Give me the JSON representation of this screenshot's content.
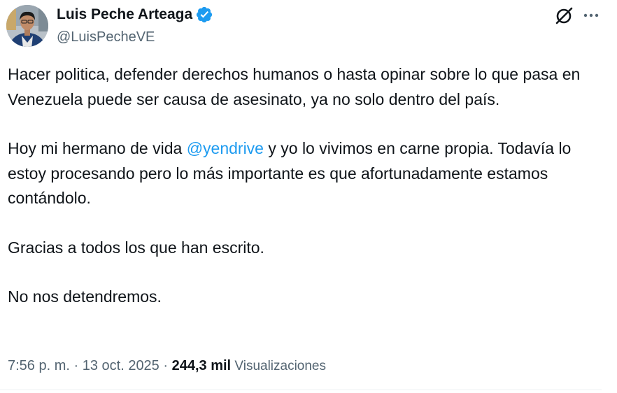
{
  "author": {
    "name": "Luis Peche Arteaga",
    "handle": "@LuisPecheVE",
    "verified_color": "#1d9bf0"
  },
  "icons": {
    "avatar": "profile-photo",
    "verified": "verified-badge-icon",
    "grok": "grok-icon",
    "more": "more-dots-icon"
  },
  "tweet": {
    "p1": "Hacer politica, defender derechos humanos o hasta opinar sobre lo que pasa en Venezuela puede ser causa de asesinato, ya no solo dentro del país.",
    "p2_before": "Hoy mi hermano de vida ",
    "p2_mention": "@yendrive",
    "p2_after": " y yo lo vivimos en carne propia. Todavía lo estoy procesando pero lo más importante es que afortunadamente estamos contándolo.",
    "p3": "Gracias a todos los que han escrito.",
    "p4": "No nos detendremos."
  },
  "meta": {
    "time": "7:56 p. m.",
    "sep1": " · ",
    "date": "13 oct. 2025",
    "sep2": " · ",
    "views_count": "244,3 mil",
    "views_label": " Visualizaciones"
  },
  "colors": {
    "text": "#0f1419",
    "secondary": "#536471",
    "link": "#1d9bf0"
  }
}
